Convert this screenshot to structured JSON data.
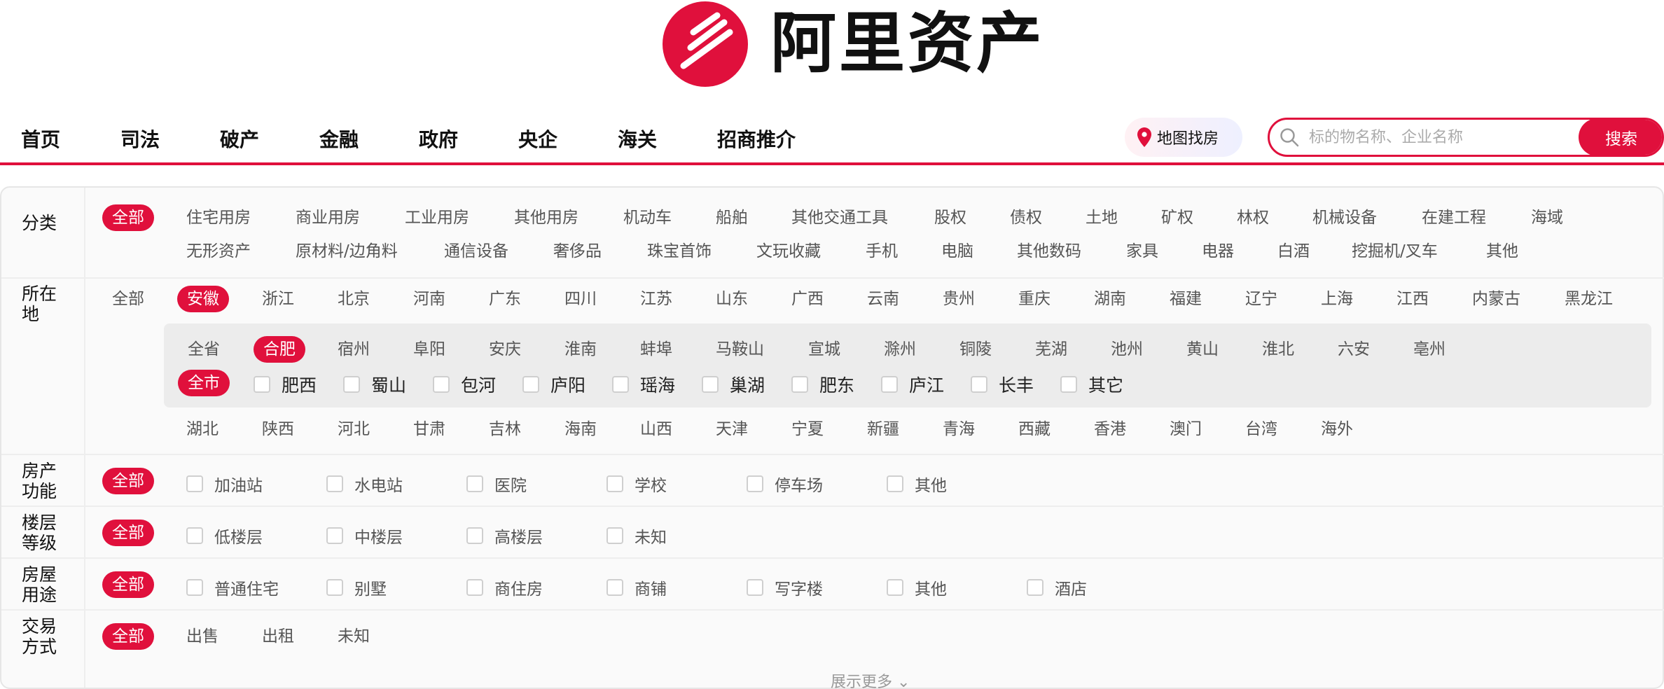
{
  "brand": {
    "name": "阿里资产",
    "accent": "#e0103c"
  },
  "nav": {
    "items": [
      "首页",
      "司法",
      "破产",
      "金融",
      "政府",
      "央企",
      "海关",
      "招商推介"
    ]
  },
  "map_button": {
    "label": "地图找房",
    "icon": "location-pin-icon"
  },
  "search": {
    "placeholder": "标的物名称、企业名称",
    "button": "搜索",
    "icon": "search-icon"
  },
  "filters": {
    "category": {
      "label": "分类",
      "selected": "全部",
      "row1": [
        "住宅用房",
        "商业用房",
        "工业用房",
        "其他用房",
        "机动车",
        "船舶",
        "其他交通工具",
        "股权",
        "债权",
        "土地",
        "矿权",
        "林权",
        "机械设备",
        "在建工程",
        "海域"
      ],
      "row2": [
        "无形资产",
        "原材料/边角料",
        "通信设备",
        "奢侈品",
        "珠宝首饰",
        "文玩收藏",
        "手机",
        "电脑",
        "其他数码",
        "家具",
        "电器",
        "白酒",
        "挖掘机/叉车",
        "其他"
      ]
    },
    "location": {
      "label": "所在地",
      "all": "全部",
      "selected": "安徽",
      "provinces_row1": [
        "浙江",
        "北京",
        "河南",
        "广东",
        "四川",
        "江苏",
        "山东",
        "广西",
        "云南",
        "贵州",
        "重庆",
        "湖南",
        "福建",
        "辽宁",
        "上海",
        "江西",
        "内蒙古",
        "黑龙江"
      ],
      "provinces_row2": [
        "湖北",
        "陕西",
        "河北",
        "甘肃",
        "吉林",
        "海南",
        "山西",
        "天津",
        "宁夏",
        "新疆",
        "青海",
        "西藏",
        "香港",
        "澳门",
        "台湾",
        "海外"
      ],
      "city_all": "全省",
      "city_selected": "合肥",
      "cities": [
        "宿州",
        "阜阳",
        "安庆",
        "淮南",
        "蚌埠",
        "马鞍山",
        "宣城",
        "滁州",
        "铜陵",
        "芜湖",
        "池州",
        "黄山",
        "淮北",
        "六安",
        "亳州"
      ],
      "district_selected": "全市",
      "districts": [
        "肥西",
        "蜀山",
        "包河",
        "庐阳",
        "瑶海",
        "巢湖",
        "肥东",
        "庐江",
        "长丰",
        "其它"
      ]
    },
    "property_function": {
      "label": "房产功能",
      "selected": "全部",
      "options": [
        "加油站",
        "水电站",
        "医院",
        "学校",
        "停车场",
        "其他"
      ]
    },
    "floor_level": {
      "label": "楼层等级",
      "selected": "全部",
      "options": [
        "低楼层",
        "中楼层",
        "高楼层",
        "未知"
      ]
    },
    "house_use": {
      "label": "房屋用途",
      "selected": "全部",
      "options": [
        "普通住宅",
        "别墅",
        "商住房",
        "商铺",
        "写字楼",
        "其他",
        "酒店"
      ]
    },
    "trade_type": {
      "label": "交易方式",
      "selected": "全部",
      "options": [
        "出售",
        "出租",
        "未知"
      ]
    }
  },
  "show_more": "展示更多"
}
